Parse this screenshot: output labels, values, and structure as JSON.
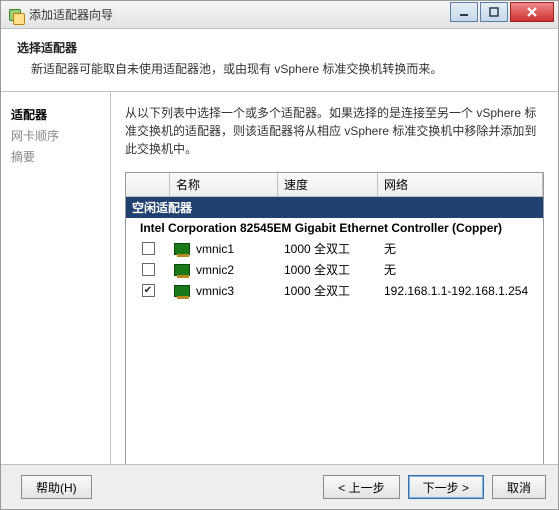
{
  "window": {
    "title": "添加适配器向导"
  },
  "header": {
    "title": "选择适配器",
    "subtitle": "新适配器可能取自未使用适配器池，或由现有 vSphere 标准交换机转换而来。"
  },
  "sidebar": {
    "items": [
      {
        "label": "适配器",
        "active": true
      },
      {
        "label": "网卡顺序",
        "active": false
      },
      {
        "label": "摘要",
        "active": false
      }
    ]
  },
  "main": {
    "hint": "从以下列表中选择一个或多个适配器。如果选择的是连接至另一个 vSphere 标准交换机的适配器，则该适配器将从相应 vSphere 标准交换机中移除并添加到此交换机中。",
    "columns": {
      "name": "名称",
      "speed": "速度",
      "network": "网络"
    },
    "group_label": "空闲适配器",
    "device_header": "Intel Corporation 82545EM Gigabit Ethernet Controller (Copper)",
    "rows": [
      {
        "checked": false,
        "name": "vmnic1",
        "speed": "1000 全双工",
        "network": "无"
      },
      {
        "checked": false,
        "name": "vmnic2",
        "speed": "1000 全双工",
        "network": "无"
      },
      {
        "checked": true,
        "name": "vmnic3",
        "speed": "1000 全双工",
        "network": "192.168.1.1-192.168.1.254"
      }
    ]
  },
  "footer": {
    "help": "帮助(H)",
    "back": "< 上一步",
    "next": "下一步 >",
    "cancel": "取消"
  }
}
